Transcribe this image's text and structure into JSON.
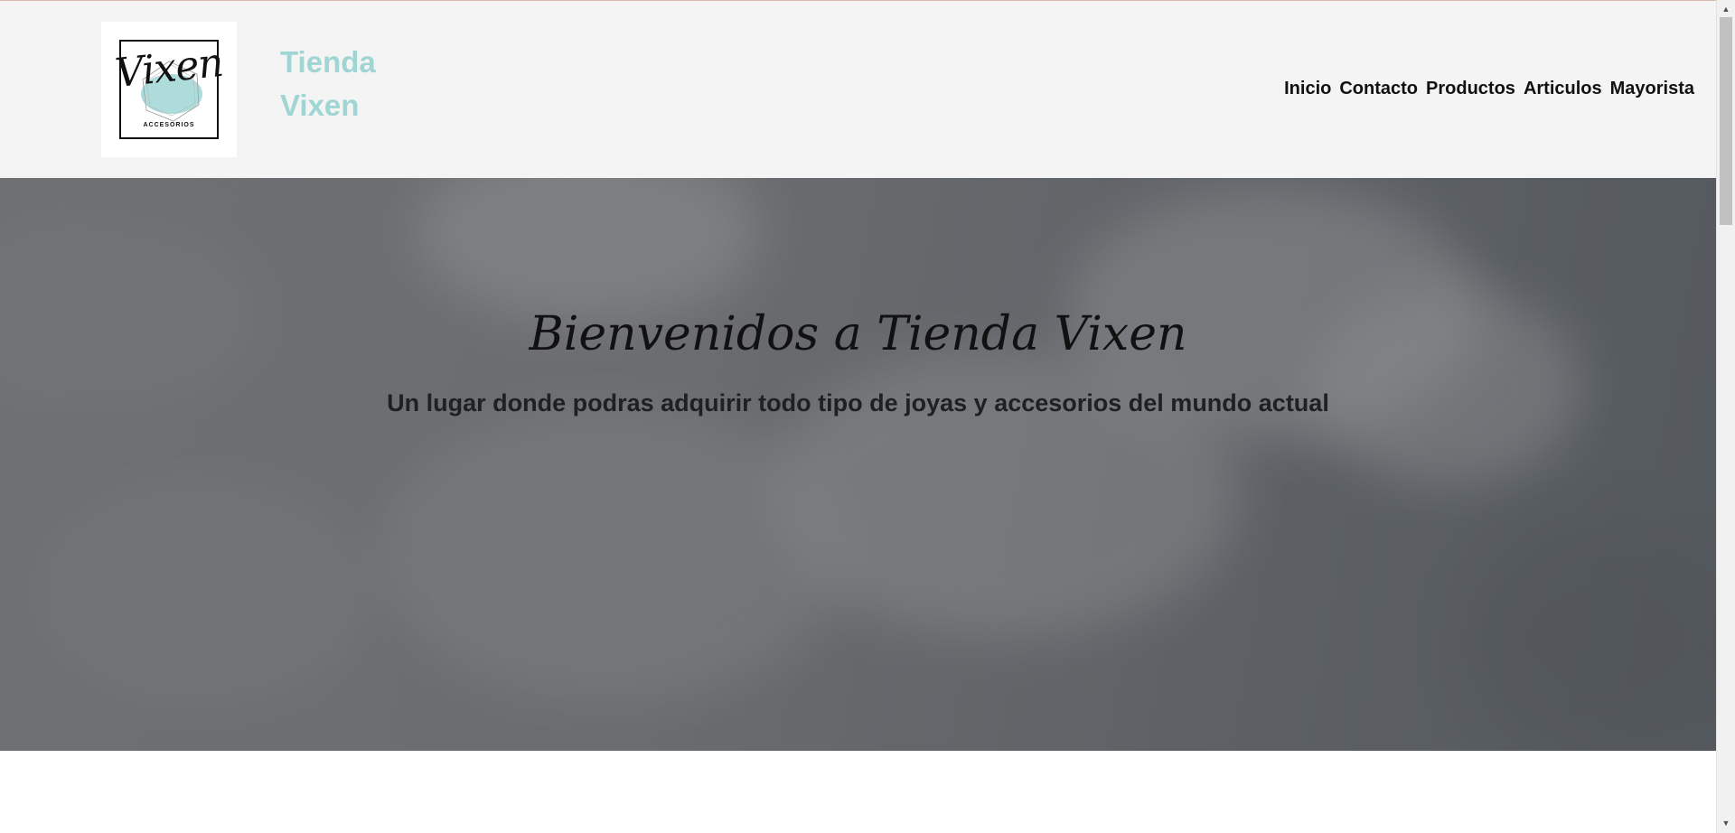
{
  "brand": {
    "logo_text": "Vixen",
    "logo_subtext": "ACCESORIOS",
    "title_line1": "Tienda",
    "title_line2": "Vixen",
    "accent_color": "#9fd6d3"
  },
  "nav": {
    "items": [
      "Inicio",
      "Contacto",
      "Productos",
      "Articulos",
      "Mayorista"
    ]
  },
  "hero": {
    "title": "Bienvenidos a Tienda Vixen",
    "subtitle": "Un lugar donde podras adquirir todo tipo de joyas y accesorios del mundo actual"
  },
  "scrollbar": {
    "up_icon": "arrow-up-icon",
    "down_icon": "arrow-down-icon"
  }
}
